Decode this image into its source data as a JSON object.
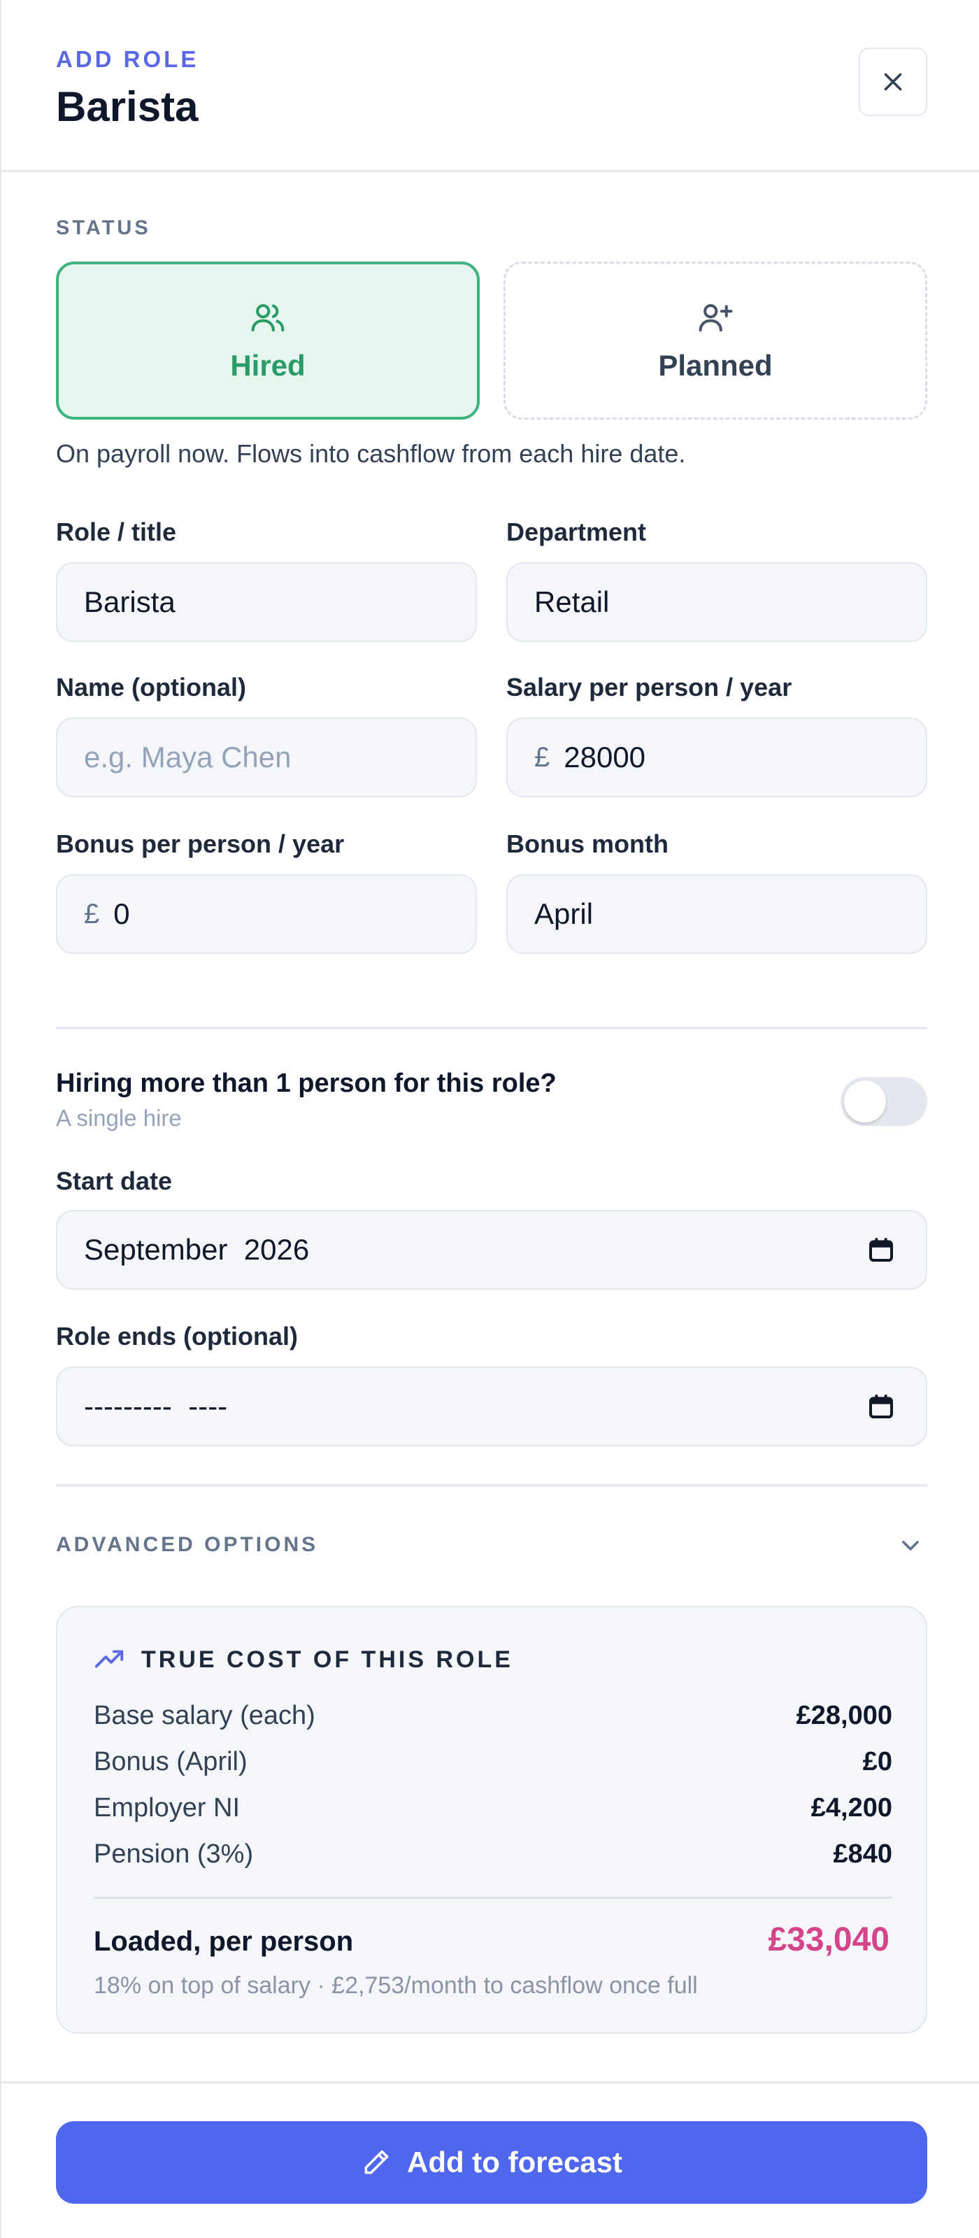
{
  "header": {
    "eyebrow": "ADD ROLE",
    "title": "Barista",
    "close_icon": "close-icon"
  },
  "status": {
    "label": "STATUS",
    "options": [
      {
        "label": "Hired",
        "icon": "users-icon",
        "selected": true
      },
      {
        "label": "Planned",
        "icon": "user-plus-icon",
        "selected": false
      }
    ],
    "help": "On payroll now. Flows into cashflow from each hire date."
  },
  "fields": {
    "role_title": {
      "label": "Role / title",
      "value": "Barista"
    },
    "department": {
      "label": "Department",
      "value": "Retail"
    },
    "name": {
      "label": "Name (optional)",
      "placeholder": "e.g. Maya Chen"
    },
    "salary": {
      "label": "Salary per person / year",
      "prefix": "£",
      "value": "28000"
    },
    "bonus": {
      "label": "Bonus per person / year",
      "prefix": "£",
      "value": "0"
    },
    "bonus_month": {
      "label": "Bonus month",
      "value": "April"
    }
  },
  "multi_hire": {
    "title": "Hiring more than 1 person for this role?",
    "subtitle": "A single hire",
    "enabled": false
  },
  "dates": {
    "start": {
      "label": "Start date",
      "value": "September  2026"
    },
    "end": {
      "label": "Role ends (optional)",
      "value": "---------  ----"
    }
  },
  "advanced": {
    "label": "ADVANCED OPTIONS"
  },
  "cost": {
    "title": "TRUE COST OF THIS ROLE",
    "icon": "trending-up-icon",
    "rows": [
      {
        "label": "Base salary (each)",
        "value": "£28,000"
      },
      {
        "label": "Bonus (April)",
        "value": "£0"
      },
      {
        "label": "Employer NI",
        "value": "£4,200"
      },
      {
        "label": "Pension (3%)",
        "value": "£840"
      }
    ],
    "loaded_label": "Loaded, per person",
    "loaded_value": "£33,040",
    "loaded_note": "18% on top of salary · £2,753/month to cashflow once full"
  },
  "footer": {
    "button_label": "Add to forecast",
    "button_icon": "pencil-icon"
  },
  "colors": {
    "accent": "#4f67ec",
    "hired": "#2a9a67",
    "loaded": "#d6458c"
  }
}
